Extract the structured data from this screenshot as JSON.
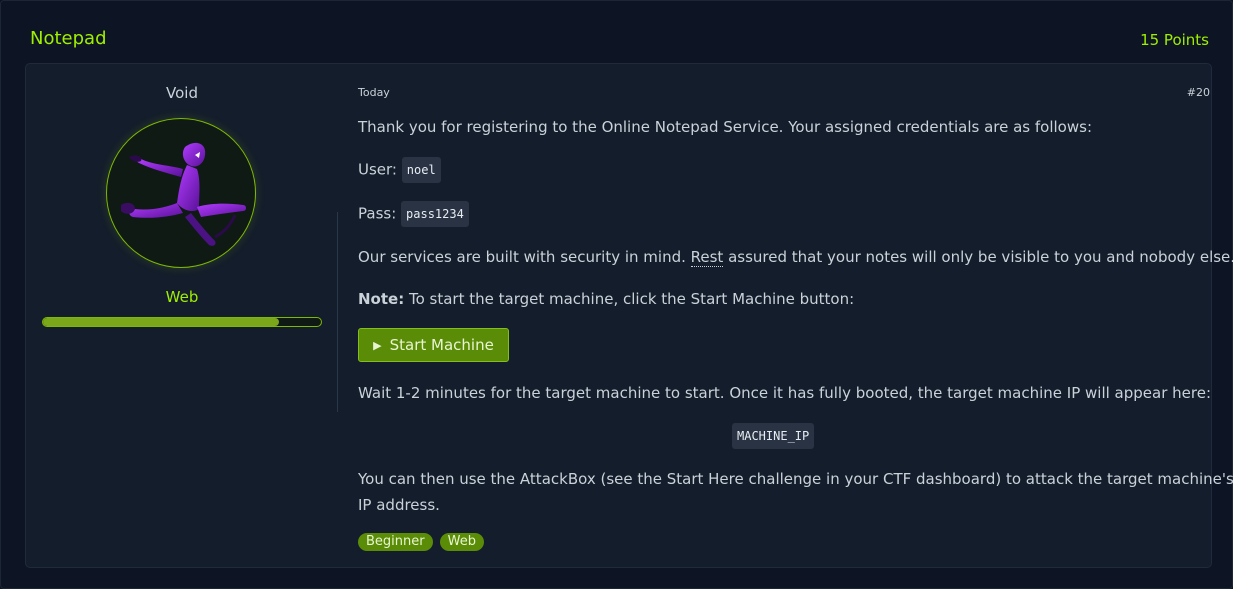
{
  "header": {
    "title": "Notepad",
    "points": "15 Points"
  },
  "author": {
    "name": "Void",
    "avatar_icon": "ninja-avatar-icon"
  },
  "category": {
    "label": "Web",
    "progress": 0.85
  },
  "post": {
    "date": "Today",
    "number": "#20",
    "intro": "Thank you for registering to the Online Notepad Service. Your assigned credentials are as follows:",
    "user_label": "User:",
    "user_value": "noel",
    "pass_label": "Pass:",
    "pass_value": "pass1234",
    "security_before": "Our services are built with security in mind. ",
    "security_word": "Rest",
    "security_after": " assured that your notes will only be visible to you and nobody else.",
    "note_bold": "Note:",
    "note_text": " To start the target machine, click the Start Machine button:",
    "start_button": "Start Machine",
    "wait_text": "Wait 1-2 minutes for the target machine to start. Once it has fully booted, the target machine IP will appear here:",
    "machine_ip": "MACHINE_IP",
    "attack_line1": "You can then use the AttackBox (see the Start Here challenge in your CTF dashboard) to attack the target machine's",
    "attack_line2": "IP address."
  },
  "tags": [
    "Beginner",
    "Web"
  ],
  "colors": {
    "accent": "#9fef00",
    "button": "#5a8c08",
    "background": "#0c1322",
    "card": "#141d2b"
  }
}
